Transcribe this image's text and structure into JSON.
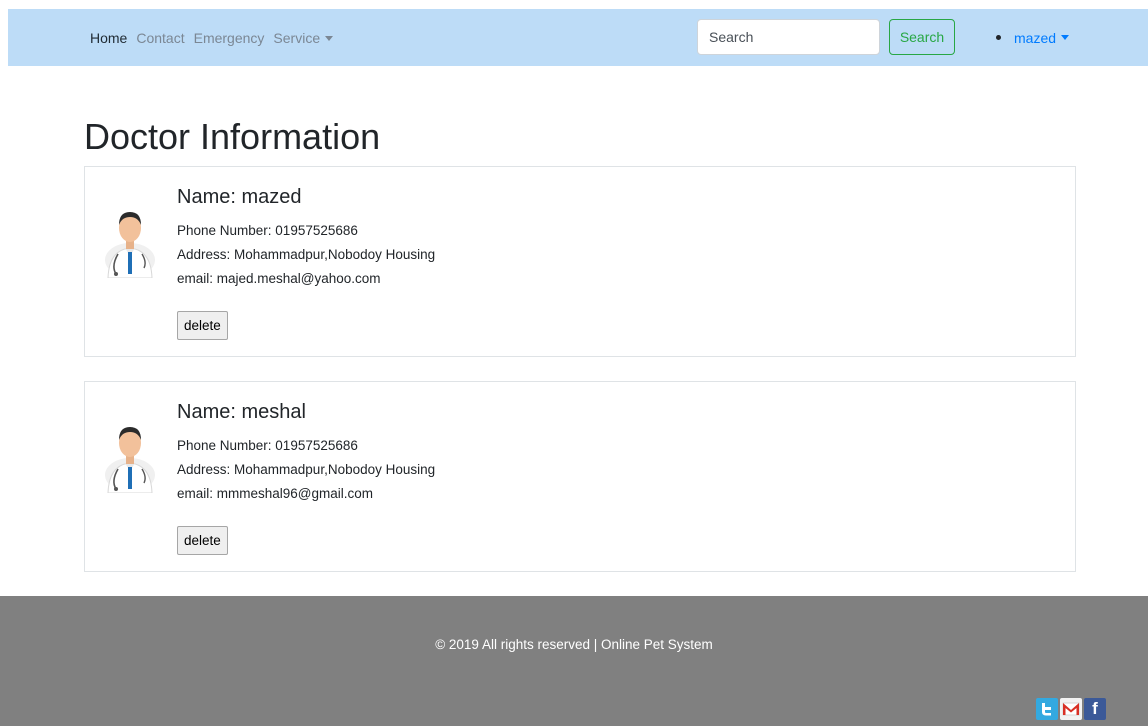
{
  "navbar": {
    "links": [
      "Home",
      "Contact",
      "Emergency",
      "Service"
    ],
    "search": {
      "placeholder": "Search",
      "button_label": "Search"
    },
    "user": {
      "name": "mazed"
    }
  },
  "page": {
    "title": "Doctor Information"
  },
  "doctors": [
    {
      "name": "Name: mazed",
      "phone": "Phone Number: 01957525686",
      "address": "Address: Mohammadpur,Nobodoy Housing",
      "email": "email: majed.meshal@yahoo.com",
      "delete_label": "delete"
    },
    {
      "name": "Name: meshal",
      "phone": "Phone Number: 01957525686",
      "address": "Address: Mohammadpur,Nobodoy Housing",
      "email": "email: mmmeshal96@gmail.com",
      "delete_label": "delete"
    }
  ],
  "footer": {
    "copyright": "© 2019 All rights reserved | Online Pet System",
    "social_icons": [
      "twitter-icon",
      "gmail-icon",
      "facebook-icon"
    ],
    "facebook_glyph": "f"
  },
  "colors": {
    "navbar_bg": "#bddcf7",
    "search_accent": "#28a745",
    "user_link": "#007bff",
    "footer_bg": "#808080"
  }
}
